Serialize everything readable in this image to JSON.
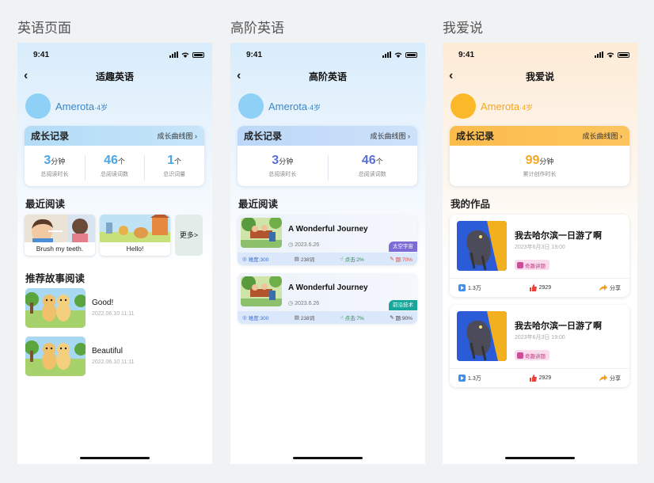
{
  "sections": [
    "英语页面",
    "高阶英语",
    "我爱说"
  ],
  "status_time": "9:41",
  "phone1": {
    "nav_title": "适趣英语",
    "profile": {
      "name": "Amerota",
      "age": "·4岁"
    },
    "growth": {
      "title": "成长记录",
      "link": "成长曲线图",
      "stats": [
        {
          "num": "3",
          "unit": "分钟",
          "label": "总阅读时长"
        },
        {
          "num": "46",
          "unit": "个",
          "label": "总阅读词数"
        },
        {
          "num": "1",
          "unit": "个",
          "label": "总识词量"
        }
      ]
    },
    "recent_title": "最近阅读",
    "recent_books": [
      {
        "caption": "Brush my teeth."
      },
      {
        "caption": "Hello!"
      }
    ],
    "more_label": "更多>",
    "recommend_title": "推荐故事阅读",
    "stories": [
      {
        "title": "Good!",
        "date": "2022.06.10 11:11"
      },
      {
        "title": "Beautiful",
        "date": "2022.06.10 11:11"
      }
    ]
  },
  "phone2": {
    "nav_title": "高阶英语",
    "profile": {
      "name": "Amerota",
      "age": "·4岁"
    },
    "growth": {
      "title": "成长记录",
      "link": "成长曲线图",
      "stats": [
        {
          "num": "3",
          "unit": "分钟",
          "label": "总阅读时长"
        },
        {
          "num": "46",
          "unit": "个",
          "label": "总阅读词数"
        }
      ]
    },
    "recent_title": "最近阅读",
    "journeys": [
      {
        "title": "A Wonderful Journey",
        "date": "2023.6.26",
        "tag": "太空宇宙",
        "tag_color": "#7d6bd6",
        "difficulty": "难度:300",
        "words": "238词",
        "clicks": "点击:2%",
        "accuracy": "题:70%",
        "acc_color": "#e04a3a"
      },
      {
        "title": "A Wonderful Journey",
        "date": "2023.6.26",
        "tag": "前沿技术",
        "tag_color": "#17a79a",
        "difficulty": "难度:300",
        "words": "238词",
        "clicks": "点击:7%",
        "accuracy": "题:90%",
        "acc_color": "#444444"
      }
    ]
  },
  "phone3": {
    "nav_title": "我爱说",
    "profile": {
      "name": "Amerota",
      "age": "·4岁"
    },
    "growth": {
      "title": "成长记录",
      "link": "成长曲线图",
      "stats": [
        {
          "num": "99",
          "unit": "分钟",
          "label": "累计创作时长"
        }
      ]
    },
    "works_title": "我的作品",
    "works": [
      {
        "title": "我去哈尔滨一日游了啊",
        "date": "2023年6月3日 19:00",
        "badge": "奇趣讲题",
        "plays": "1.3万",
        "likes": "2929",
        "share": "分享"
      },
      {
        "title": "我去哈尔滨一日游了啊",
        "date": "2023年6月3日 19:00",
        "badge": "奇趣讲题",
        "plays": "1.3万",
        "likes": "2929",
        "share": "分享"
      }
    ]
  }
}
